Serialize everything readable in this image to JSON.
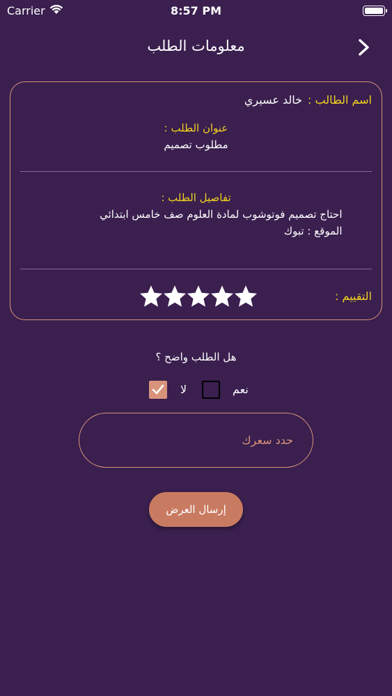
{
  "status_bar": {
    "carrier": "Carrier",
    "time": "8:57 PM"
  },
  "nav": {
    "title": "معلومات الطلب"
  },
  "card": {
    "student_label": "اسم الطالب :",
    "student_name": "خالد عسيري",
    "title_label": "عنوان الطلب :",
    "title_value": "مطلوب تصميم",
    "details_label": "تفاصيل الطلب :",
    "details_value": "احتاج تصميم فوتوشوب لمادة العلوم صف خامس ابتدائي",
    "location": "الموقع : تبوك",
    "rating_label": "التقييم :",
    "rating_value": 5,
    "rating_max": 5
  },
  "question": {
    "text": "هل الطلب واضح ؟",
    "yes_label": "نعم",
    "no_label": "لا",
    "yes_checked": false,
    "no_checked": true
  },
  "price": {
    "placeholder": "حدد سعرك",
    "value": ""
  },
  "submit": {
    "label": "إرسال العرض"
  },
  "colors": {
    "background": "#3a1f4f",
    "accent": "#d9937a",
    "label_yellow": "#f2d31f",
    "button": "#c97b62"
  }
}
